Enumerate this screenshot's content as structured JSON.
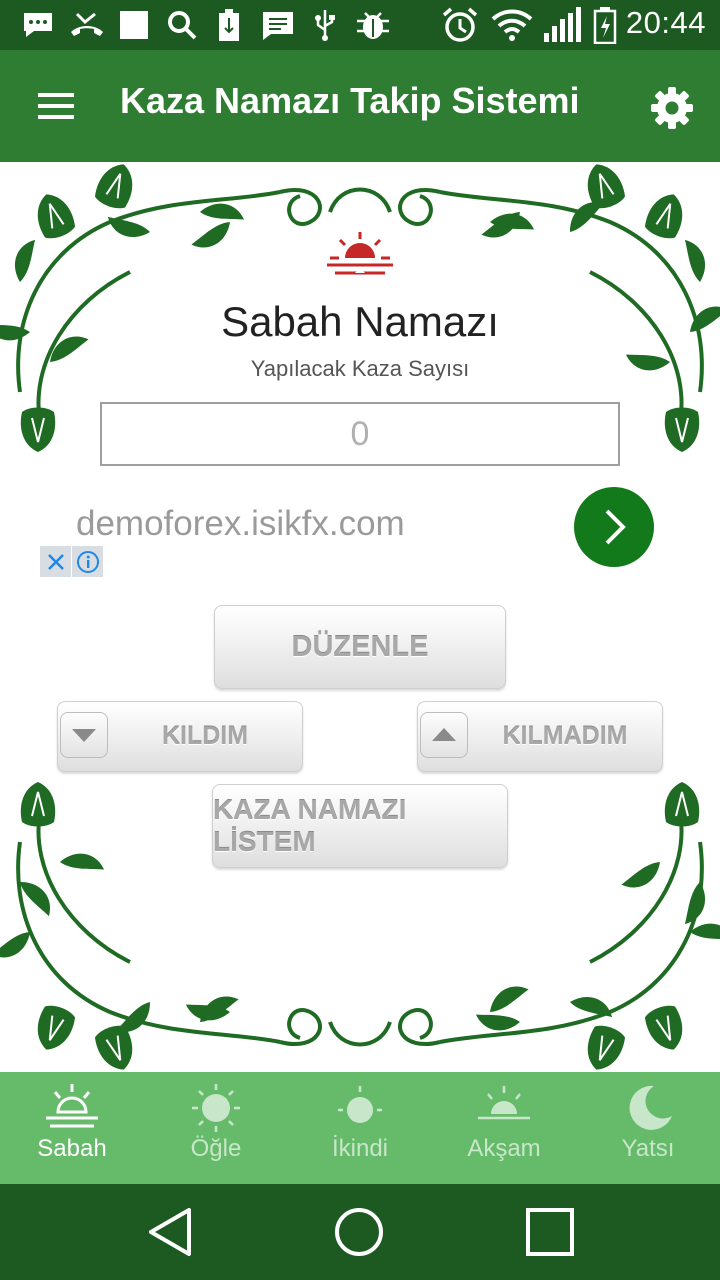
{
  "status_bar": {
    "time": "20:44",
    "icons": [
      "messages-icon",
      "missed-call-icon",
      "stop-icon",
      "search-icon",
      "sd-card-icon",
      "sms-icon",
      "usb-icon",
      "debug-icon",
      "alarm-icon",
      "wifi-icon",
      "signal-icon",
      "battery-charging-icon"
    ]
  },
  "app_bar": {
    "title": "Kaza Namazı Takip Sistemi",
    "menu_icon": "hamburger-menu-icon",
    "settings_icon": "gear-icon"
  },
  "prayer": {
    "name": "Sabah Namazı",
    "subtitle": "Yapılacak Kaza Sayısı",
    "count_placeholder": "0",
    "icon": "sunrise-icon",
    "icon_color": "#c62828"
  },
  "ad": {
    "url": "demoforex.isikfx.com",
    "go_icon": "chevron-right-icon",
    "close_icon": "close-icon",
    "info_icon": "info-icon",
    "accent": "#137a1b"
  },
  "buttons": {
    "edit": "DÜZENLE",
    "prayed": "KILDIM",
    "not_prayed": "KILMADIM",
    "list": "KAZA NAMAZI LİSTEM"
  },
  "tabs": [
    {
      "label": "Sabah",
      "icon": "sunrise-icon",
      "active": true
    },
    {
      "label": "Öğle",
      "icon": "sun-icon",
      "active": false
    },
    {
      "label": "İkindi",
      "icon": "afternoon-sun-icon",
      "active": false
    },
    {
      "label": "Akşam",
      "icon": "sunset-icon",
      "active": false
    },
    {
      "label": "Yatsı",
      "icon": "moon-icon",
      "active": false
    }
  ],
  "colors": {
    "status_bar": "#1d5a22",
    "app_bar": "#2e7d32",
    "tab_bar": "#66bb6a",
    "decor": "#1f6b24"
  }
}
